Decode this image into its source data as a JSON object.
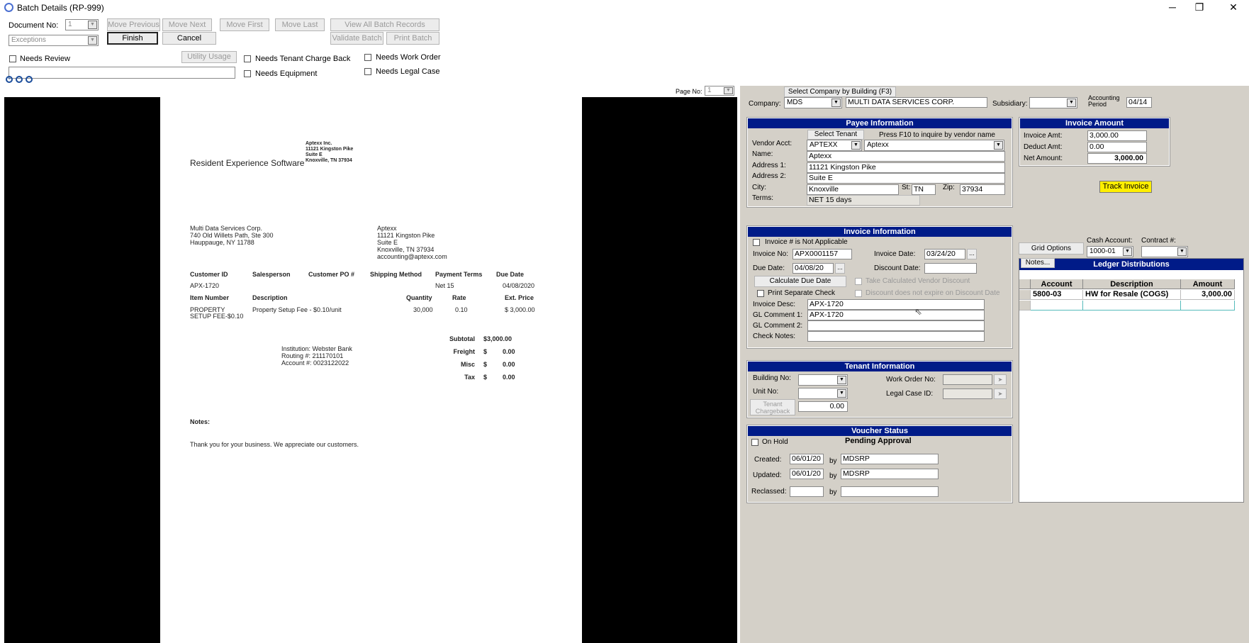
{
  "window": {
    "title": "Batch Details (RP-999)",
    "min": "─",
    "restore": "❐",
    "close": "✕"
  },
  "toolbar": {
    "document_no_label": "Document No:",
    "document_no_value": "1",
    "view_select": "Exceptions",
    "move_previous": "Move Previous",
    "move_next": "Move Next",
    "move_first": "Move First",
    "move_last": "Move Last",
    "view_all": "View All Batch Records",
    "finish": "Finish",
    "cancel": "Cancel",
    "validate_batch": "Validate Batch",
    "print_batch": "Print Batch",
    "utility_usage": "Utility Usage",
    "needs_review": "Needs Review",
    "needs_tenant_charge_back": "Needs Tenant Charge Back",
    "needs_equipment": "Needs Equipment",
    "needs_work_order": "Needs Work Order",
    "needs_legal_case": "Needs Legal Case"
  },
  "viewer": {
    "page_no_label": "Page No:",
    "page_no_value": "1"
  },
  "invoice_doc": {
    "company_banner": "Resident Experience Software",
    "vendor_header": [
      "Aptexx Inc.",
      "11121 Kingston Pike",
      "Suite E",
      "Knoxville, TN 37934"
    ],
    "bill_to": [
      "Multi Data Services Corp.",
      "740 Old Willets Path, Ste 300",
      "Hauppauge, NY 11788"
    ],
    "remit_to": [
      "Aptexx",
      "11121 Kingston Pike",
      "Suite E",
      "Knoxville, TN 37934",
      "accounting@aptexx.com"
    ],
    "hdr1": [
      "Customer ID",
      "Salesperson",
      "Customer PO #",
      "Shipping Method",
      "Payment Terms",
      "Due Date"
    ],
    "row1": {
      "customer_id": "APX-1720",
      "terms": "Net 15",
      "due": "04/08/2020"
    },
    "hdr2": [
      "Item Number",
      "Description",
      "Quantity",
      "Rate",
      "Ext. Price"
    ],
    "item": {
      "number": "PROPERTY",
      "number2": "SETUP FEE-$0.10",
      "desc": "Property Setup Fee - $0.10/unit",
      "qty": "30,000",
      "rate": "0.10",
      "ext": "$ 3,000.00"
    },
    "bank": [
      "Institution: Webster Bank",
      "Routing #: 211170101",
      "Account #: 0023122022"
    ],
    "totals": [
      {
        "label": "Subtotal",
        "cur": "",
        "amt": "$3,000.00"
      },
      {
        "label": "Freight",
        "cur": "$",
        "amt": "0.00"
      },
      {
        "label": "Misc",
        "cur": "$",
        "amt": "0.00"
      },
      {
        "label": "Tax",
        "cur": "$",
        "amt": "0.00"
      }
    ],
    "notes_label": "Notes:",
    "thanks": "Thank you for your business.  We appreciate our customers."
  },
  "company": {
    "select_btn": "Select Company by Building (F3)",
    "label": "Company:",
    "code": "MDS",
    "name": "MULTI DATA SERVICES CORP.",
    "subsidiary_label": "Subsidiary:",
    "period_label1": "Accounting",
    "period_label2": "Period",
    "period": "04/14"
  },
  "payee": {
    "header": "Payee Information",
    "select_tenant": "Select Tenant",
    "f10_hint": "Press F10 to inquire by vendor name",
    "vendor_acct_label": "Vendor Acct:",
    "vendor_acct": "APTEXX",
    "vendor_name_sel": "Aptexx",
    "name_label": "Name:",
    "name": "Aptexx",
    "addr1_label": "Address 1:",
    "addr1": "11121 Kingston Pike",
    "addr2_label": "Address 2:",
    "addr2": "Suite E",
    "city_label": "City:",
    "city": "Knoxville",
    "st_label": "St:",
    "st": "TN",
    "zip_label": "Zip:",
    "zip": "37934",
    "terms_label": "Terms:",
    "terms": "NET 15 days"
  },
  "amount": {
    "header": "Invoice Amount",
    "invoice_amt_label": "Invoice Amt:",
    "invoice_amt": "3,000.00",
    "deduct_amt_label": "Deduct Amt:",
    "deduct_amt": "0.00",
    "net_amount_label": "Net Amount:",
    "net_amount": "3,000.00",
    "track_invoice": "Track Invoice"
  },
  "invoice_info": {
    "header": "Invoice Information",
    "not_applicable": "Invoice # is Not Applicable",
    "invoice_no_label": "Invoice No:",
    "invoice_no": "APX0001157",
    "invoice_date_label": "Invoice Date:",
    "invoice_date": "03/24/20",
    "due_date_label": "Due Date:",
    "due_date": "04/08/20",
    "discount_date_label": "Discount Date:",
    "calc_due_date": "Calculate Due Date",
    "take_calc_discount": "Take Calculated Vendor Discount",
    "print_separate": "Print Separate Check",
    "discount_no_expire": "Discount does not expire on Discount Date",
    "desc_label": "Invoice Desc:",
    "desc": "APX-1720",
    "gl1_label": "GL Comment 1:",
    "gl1": "APX-1720",
    "gl2_label": "GL Comment 2:",
    "check_notes_label": "Check Notes:"
  },
  "tenant": {
    "header": "Tenant Information",
    "building_label": "Building No:",
    "unit_label": "Unit No:",
    "chargeback_btn1": "Tenant",
    "chargeback_btn2": "Chargeback",
    "chargeback_amt": "0.00",
    "work_order_label": "Work Order No:",
    "legal_case_label": "Legal Case ID:"
  },
  "voucher": {
    "header": "Voucher Status",
    "on_hold": "On Hold",
    "status": "Pending Approval",
    "created_label": "Created:",
    "created": "06/01/20",
    "by": "by",
    "created_by": "MDSRP",
    "updated_label": "Updated:",
    "updated": "06/01/20",
    "updated_by": "MDSRP",
    "reclassed_label": "Reclassed:"
  },
  "ledger": {
    "grid_options": "Grid Options",
    "notes_btn": "Notes...",
    "cash_account_label": "Cash Account:",
    "cash_account": "1000-01",
    "contract_label": "Contract #:",
    "header": "Ledger Distributions",
    "columns": [
      "Account",
      "Description",
      "Amount"
    ],
    "rows": [
      {
        "account": "5800-03",
        "description": "HW for Resale (COGS)",
        "amount": "3,000.00"
      }
    ]
  }
}
